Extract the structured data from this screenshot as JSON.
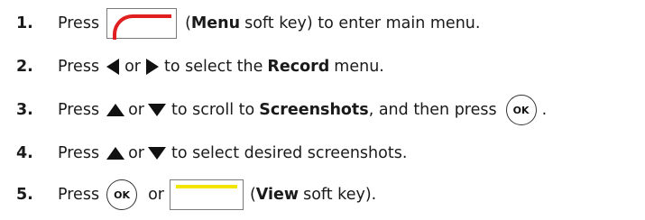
{
  "steps": [
    {
      "number": "1.",
      "press": "Press",
      "open_paren": "(",
      "menu_key": "Menu",
      "rest": "soft key) to enter main menu."
    },
    {
      "number": "2.",
      "press": "Press",
      "or": "or",
      "mid": "to select the",
      "record": "Record",
      "end": "menu."
    },
    {
      "number": "3.",
      "press": "Press",
      "or": "or",
      "mid": "to scroll to",
      "screenshots": "Screenshots",
      "end": ", and then press",
      "ok": "OK",
      "period": "."
    },
    {
      "number": "4.",
      "press": "Press",
      "or": "or",
      "end": "to select desired screenshots."
    },
    {
      "number": "5.",
      "press": "Press",
      "ok": "OK",
      "or": "or",
      "open_paren": "(",
      "view_key": "View",
      "rest": "soft key)."
    }
  ],
  "icons": {
    "menu_softkey_color": "#e02020",
    "view_softkey_color": "#f2e600"
  }
}
